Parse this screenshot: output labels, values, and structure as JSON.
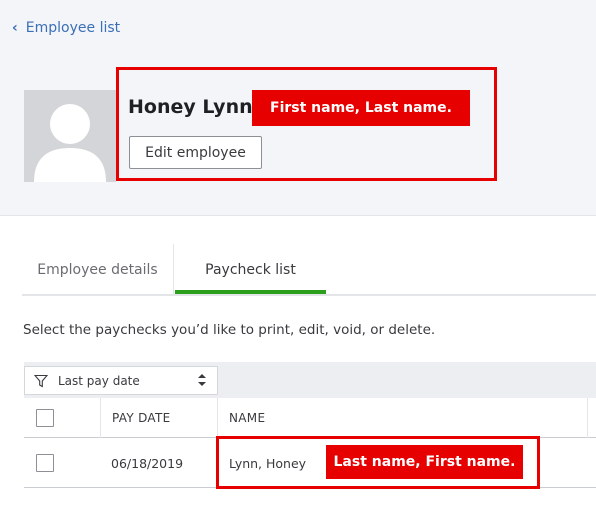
{
  "nav": {
    "back_label": "Employee list"
  },
  "employee": {
    "name": "Honey Lynn",
    "edit_label": "Edit employee"
  },
  "annotations": {
    "header_note": "First name, Last name.",
    "row_note": "Last name, First name.",
    "color": "#e60000"
  },
  "tabs": [
    {
      "label": "Employee details",
      "active": false
    },
    {
      "label": "Paycheck list",
      "active": true
    }
  ],
  "instruction": "Select the paychecks you’d like to print, edit, void, or delete.",
  "filter": {
    "label": "Last pay date"
  },
  "table": {
    "columns": [
      "PAY DATE",
      "NAME"
    ],
    "rows": [
      {
        "pay_date": "06/18/2019",
        "name": "Lynn, Honey"
      }
    ]
  },
  "colors": {
    "accent_green": "#2ca01c",
    "link_blue": "#3b6fb6"
  }
}
